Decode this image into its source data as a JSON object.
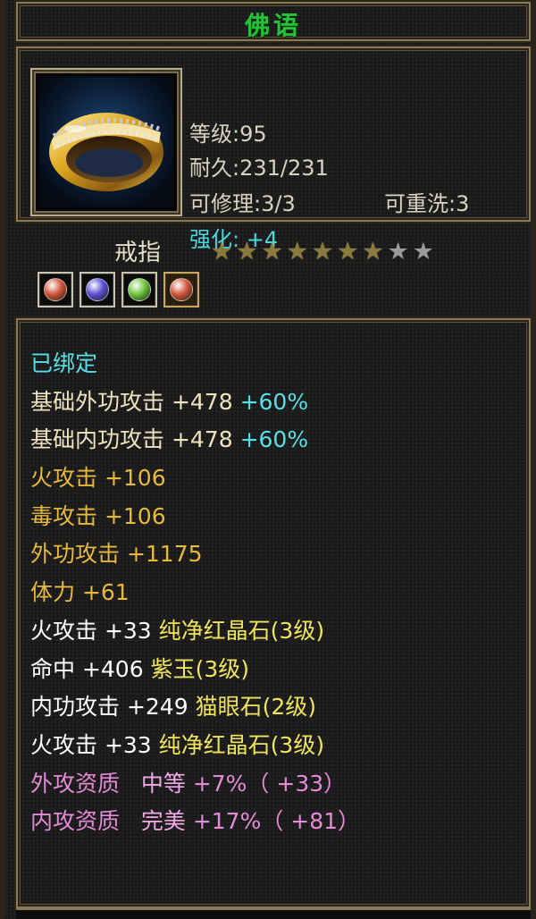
{
  "title": "佛语",
  "item": {
    "level": "等级:95",
    "durability": "耐久:231/231",
    "repair": "可修理:3/3",
    "rewash": "可重洗:3",
    "enhance": "强化: +4",
    "type": "戒指",
    "stars_filled": 7,
    "stars_total": 9
  },
  "gems": [
    {
      "icon": "red-crystal-gem-icon",
      "color": "#d2553a"
    },
    {
      "icon": "purple-jade-gem-icon",
      "color": "#5a4fd6"
    },
    {
      "icon": "green-cats-eye-gem-icon",
      "color": "#6cc43a"
    },
    {
      "icon": "red-crystal-gem-icon",
      "color": "#d2553a"
    }
  ],
  "stats": {
    "bound": "已绑定",
    "base_outer_attack": "基础外功攻击 +478",
    "base_outer_pct": "+60%",
    "base_inner_attack": "基础内功攻击 +478",
    "base_inner_pct": "+60%",
    "fire_attack": "火攻击 +106",
    "poison_attack": "毒攻击 +106",
    "outer_attack": "外功攻击 +1175",
    "stamina": "体力 +61",
    "gem1_value": "火攻击 +33",
    "gem1_name": "纯净红晶石(3级)",
    "gem2_value": "命中 +406",
    "gem2_name": "紫玉(3级)",
    "gem3_value": "内功攻击 +249",
    "gem3_name": "猫眼石(2级)",
    "gem4_value": "火攻击 +33",
    "gem4_name": "纯净红晶石(3级)",
    "outer_quality_label": "外攻资质",
    "outer_quality_grade": "中等",
    "outer_quality_value": "+7%（ +33）",
    "inner_quality_label": "内攻资质",
    "inner_quality_grade": "完美",
    "inner_quality_value": "+17%（ +81）"
  },
  "colors": {
    "title": "#23c23a",
    "enhance": "#45d8df",
    "base": "#eee2bf",
    "attribute": "#e6b83c",
    "gem_name": "#f0e45a",
    "quality": "#e58ad6"
  }
}
